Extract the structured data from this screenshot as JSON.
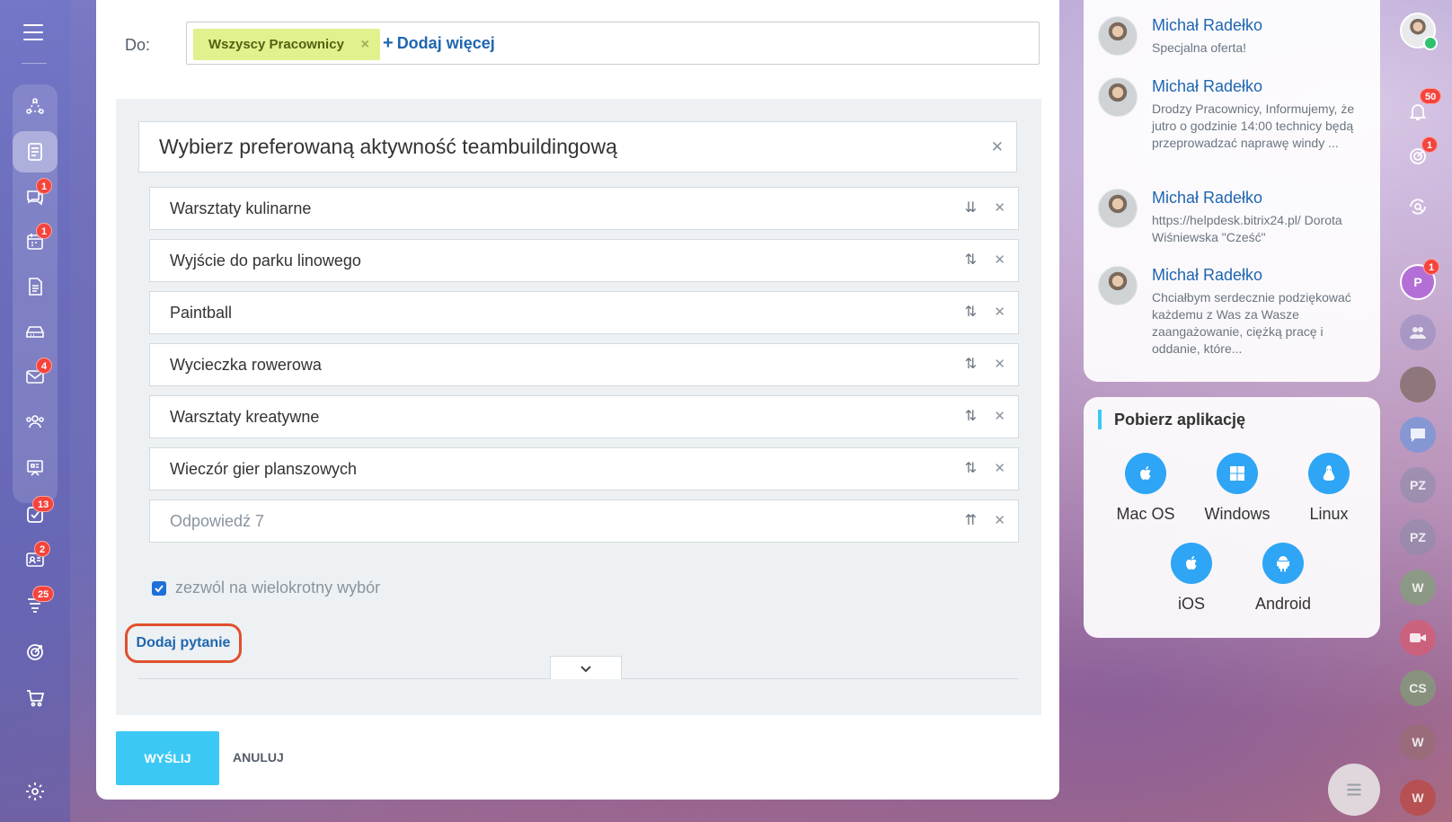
{
  "left_rail": {
    "items": [
      {
        "icon": "workflow-icon",
        "name": "rail-item-workflows"
      },
      {
        "icon": "feed-icon",
        "name": "rail-item-feed",
        "active": true
      },
      {
        "icon": "chat-icon",
        "name": "rail-item-messenger",
        "badge": "1"
      },
      {
        "icon": "calendar-icon",
        "name": "rail-item-calendar",
        "badge": "1"
      },
      {
        "icon": "document-icon",
        "name": "rail-item-documents"
      },
      {
        "icon": "drive-icon",
        "name": "rail-item-drive"
      },
      {
        "icon": "mail-icon",
        "name": "rail-item-mail",
        "badge": "4"
      },
      {
        "icon": "contacts-icon",
        "name": "rail-item-contacts"
      },
      {
        "icon": "presentation-icon",
        "name": "rail-item-knowledge"
      },
      {
        "icon": "tasks-icon",
        "name": "rail-item-tasks",
        "badge": "13"
      },
      {
        "icon": "crm-icon",
        "name": "rail-item-crm",
        "badge": "2"
      },
      {
        "icon": "funnel-icon",
        "name": "rail-item-marketing",
        "badge": "25"
      },
      {
        "icon": "target-icon",
        "name": "rail-item-sites"
      },
      {
        "icon": "cart-icon",
        "name": "rail-item-shop"
      }
    ]
  },
  "compose": {
    "to_label": "Do:",
    "recipient_tag": "Wszyscy Pracownicy",
    "add_more": "Dodaj więcej"
  },
  "poll": {
    "question": "Wybierz preferowaną aktywność teambuildingową",
    "answers": [
      {
        "text": "Warsztaty kulinarne",
        "sort": "⇊",
        "placeholder": false
      },
      {
        "text": "Wyjście do parku linowego",
        "sort": "⇅",
        "placeholder": false
      },
      {
        "text": "Paintball",
        "sort": "⇅",
        "placeholder": false
      },
      {
        "text": "Wycieczka rowerowa",
        "sort": "⇅",
        "placeholder": false
      },
      {
        "text": "Warsztaty kreatywne",
        "sort": "⇅",
        "placeholder": false
      },
      {
        "text": "Wieczór gier planszowych",
        "sort": "⇅",
        "placeholder": false
      },
      {
        "text": "Odpowiedź 7",
        "sort": "⇈",
        "placeholder": true
      }
    ],
    "multi_choice_label": "zezwól na wielokrotny wybór",
    "add_question": "Dodaj pytanie"
  },
  "actions": {
    "send": "WYŚLIJ",
    "cancel": "ANULUJ"
  },
  "news": [
    {
      "author": "Michał Radełko",
      "text": "Specjalna oferta!"
    },
    {
      "author": "Michał Radełko",
      "text": "Drodzy Pracownicy, Informujemy, że jutro o godzinie 14:00 technicy będą przeprowadzać naprawę windy ..."
    },
    {
      "author": "Michał Radełko",
      "text": "https://helpdesk.bitrix24.pl/ Dorota Wiśniewska \"Cześć\""
    },
    {
      "author": "Michał Radełko",
      "text": "Chciałbym serdecznie podziękować każdemu z Was za Wasze zaangażowanie, ciężką pracę i oddanie, które..."
    }
  ],
  "apps": {
    "title": "Pobierz aplikację",
    "items": [
      "Mac OS",
      "Windows",
      "Linux",
      "iOS",
      "Android"
    ]
  },
  "right_rail": {
    "notifications_badge": "50",
    "rating_badge": "1",
    "p_avatar_letter": "P",
    "p_avatar_badge": "1",
    "avatars": [
      "PZ",
      "PZ",
      "W",
      "CS",
      "W",
      "W"
    ]
  },
  "colors": {
    "accent": "#3bc8f5",
    "link": "#2066b0",
    "tag_bg": "#e1f18d",
    "badge": "#f5443c",
    "highlight_border": "#e0502c"
  }
}
